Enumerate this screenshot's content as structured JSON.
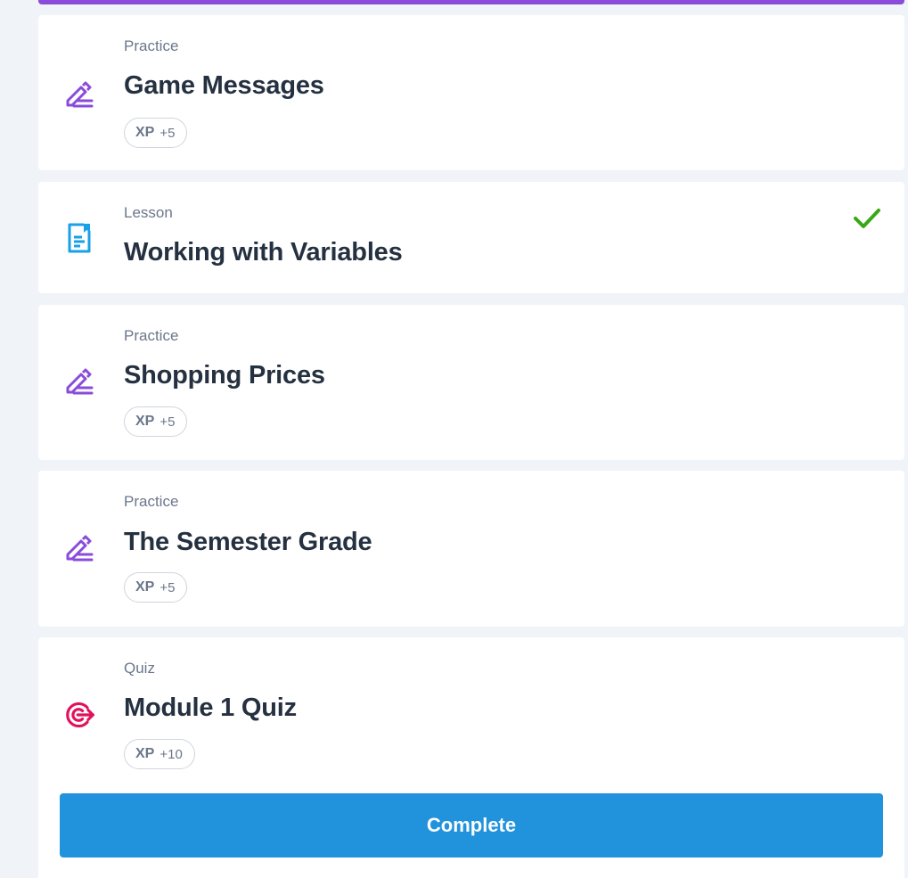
{
  "colors": {
    "background": "#f0f3f7",
    "accent_purple": "#8a4bdb",
    "lesson_blue": "#1aa0e6",
    "quiz_red": "#e0125c",
    "check_green": "#3aa815",
    "button_blue": "#2192dc"
  },
  "items": [
    {
      "type": "Practice",
      "title": "Game Messages",
      "icon": "pencil-lines-icon",
      "xp_label": "XP",
      "xp_value": "+5",
      "completed": false
    },
    {
      "type": "Lesson",
      "title": "Working with Variables",
      "icon": "document-bookmark-icon",
      "completed": true
    },
    {
      "type": "Practice",
      "title": "Shopping Prices",
      "icon": "pencil-lines-icon",
      "xp_label": "XP",
      "xp_value": "+5",
      "completed": false
    },
    {
      "type": "Practice",
      "title": "The Semester Grade",
      "icon": "pencil-lines-icon",
      "xp_label": "XP",
      "xp_value": "+5",
      "completed": false
    },
    {
      "type": "Quiz",
      "title": "Module 1 Quiz",
      "icon": "target-icon",
      "xp_label": "XP",
      "xp_value": "+10",
      "completed": false
    }
  ],
  "complete_button_label": "Complete"
}
